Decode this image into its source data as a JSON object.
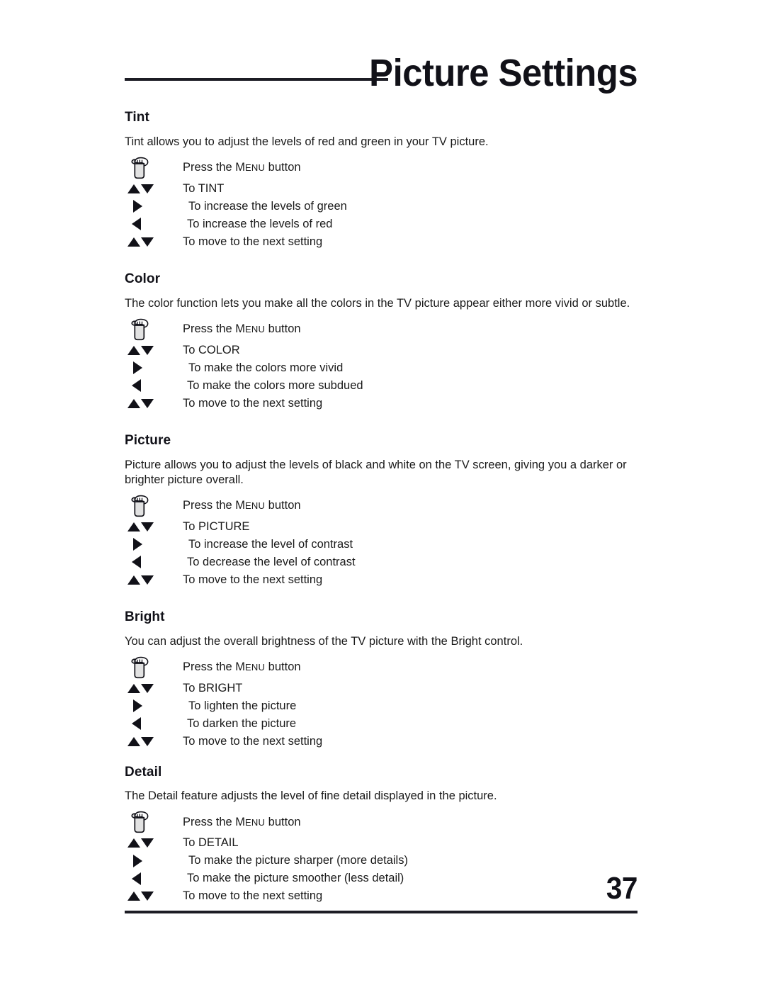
{
  "header": {
    "title": "Picture Settings",
    "rule": true
  },
  "footer": {
    "page_number": "37"
  },
  "cues": {
    "hand": "pointing-hand-icon",
    "updown": "up-down-arrows-icon",
    "right": "right-arrow-icon",
    "left": "left-arrow-icon"
  },
  "sections": [
    {
      "heading": "Tint",
      "description": "Tint allows you to adjust the levels of red and green in your TV picture.",
      "steps": [
        {
          "cue": "hand",
          "text_prefix": "Press the M",
          "text_smallcap": "ENU",
          "text_suffix": " button"
        },
        {
          "cue": "updown",
          "text": "To TINT"
        },
        {
          "cue": "right",
          "text": "To increase the levels of green"
        },
        {
          "cue": "left",
          "text": "To increase the levels of red"
        },
        {
          "cue": "updown",
          "text": "To move to the next setting"
        }
      ]
    },
    {
      "heading": "Color",
      "description": "The color function lets you make all the colors in the TV picture appear either more vivid or subtle.",
      "steps": [
        {
          "cue": "hand",
          "text_prefix": "Press the M",
          "text_smallcap": "ENU",
          "text_suffix": " button"
        },
        {
          "cue": "updown",
          "text": "To COLOR"
        },
        {
          "cue": "right",
          "text": "To make the colors more vivid"
        },
        {
          "cue": "left",
          "text": "To make the colors more subdued"
        },
        {
          "cue": "updown",
          "text": "To move to the next setting"
        }
      ]
    },
    {
      "heading": "Picture",
      "description": "Picture allows you to adjust the levels of black and white on the TV screen, giving you a darker or brighter picture overall.",
      "steps": [
        {
          "cue": "hand",
          "text_prefix": "Press the M",
          "text_smallcap": "ENU",
          "text_suffix": " button"
        },
        {
          "cue": "updown",
          "text": "To PICTURE"
        },
        {
          "cue": "right",
          "text": "To increase the level of contrast"
        },
        {
          "cue": "left",
          "text": "To decrease the level of contrast"
        },
        {
          "cue": "updown",
          "text": "To move to the next setting"
        }
      ]
    },
    {
      "heading": "Bright",
      "description": "You can adjust the overall brightness of the TV picture with the Bright control.",
      "steps": [
        {
          "cue": "hand",
          "text_prefix": "Press the M",
          "text_smallcap": "ENU",
          "text_suffix": " button"
        },
        {
          "cue": "updown",
          "text": "To BRIGHT"
        },
        {
          "cue": "right",
          "text": "To lighten the picture"
        },
        {
          "cue": "left",
          "text": "To darken the picture"
        },
        {
          "cue": "updown",
          "text": "To move to the next setting"
        }
      ]
    },
    {
      "heading": "Detail",
      "description": "The Detail feature adjusts the level of fine detail displayed in the picture.",
      "steps": [
        {
          "cue": "hand",
          "text_prefix": "Press the M",
          "text_smallcap": "ENU",
          "text_suffix": " button"
        },
        {
          "cue": "updown",
          "text": "To DETAIL"
        },
        {
          "cue": "right",
          "text": "To make the picture sharper (more details)"
        },
        {
          "cue": "left",
          "text": "To make the picture smoother (less detail)"
        },
        {
          "cue": "updown",
          "text": "To move to the next setting"
        }
      ]
    }
  ],
  "section_spacing": {
    "Tint": 30,
    "Color": 30,
    "Picture": 30,
    "Bright": 21,
    "Detail": 0
  }
}
